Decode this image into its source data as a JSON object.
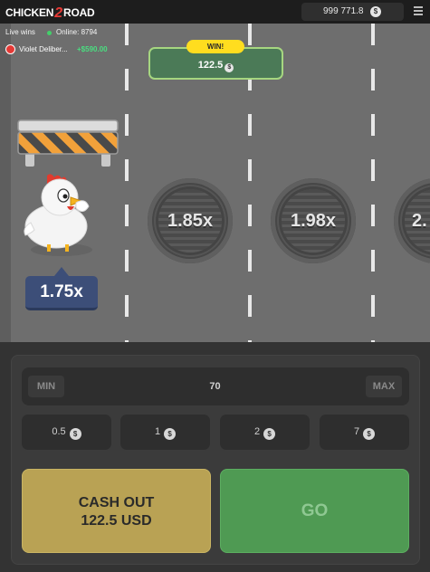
{
  "header": {
    "logo_part1": "CHICKEN",
    "logo_part2": "2",
    "logo_part3": "ROAD",
    "balance": "999 771.8",
    "currency_icon": "$"
  },
  "live": {
    "label": "Live wins",
    "online": "Online: 8794",
    "last_win_user": "Violet Deliber...",
    "last_win_amount": "+$590.00"
  },
  "win": {
    "badge": "WIN!",
    "amount": "122.5",
    "currency_icon": "$"
  },
  "road": {
    "current_multiplier": "1.75x",
    "next_multipliers": [
      "1.85x",
      "1.98x",
      "2."
    ]
  },
  "controls": {
    "min_label": "MIN",
    "max_label": "MAX",
    "bet_value": "70",
    "chips": [
      {
        "value": "0.5",
        "currency_icon": "$"
      },
      {
        "value": "1",
        "currency_icon": "$"
      },
      {
        "value": "2",
        "currency_icon": "$"
      },
      {
        "value": "7",
        "currency_icon": "$"
      }
    ],
    "cashout_line1": "CASH OUT",
    "cashout_line2": "122.5 USD",
    "go_label": "GO"
  },
  "colors": {
    "road": "#6e6e6e",
    "multiplier_tag": "#3c4e78",
    "cashout": "#b9a254",
    "go": "#4f9a53",
    "win_box": "#4b7a57",
    "win_badge": "#ffdd1f"
  }
}
